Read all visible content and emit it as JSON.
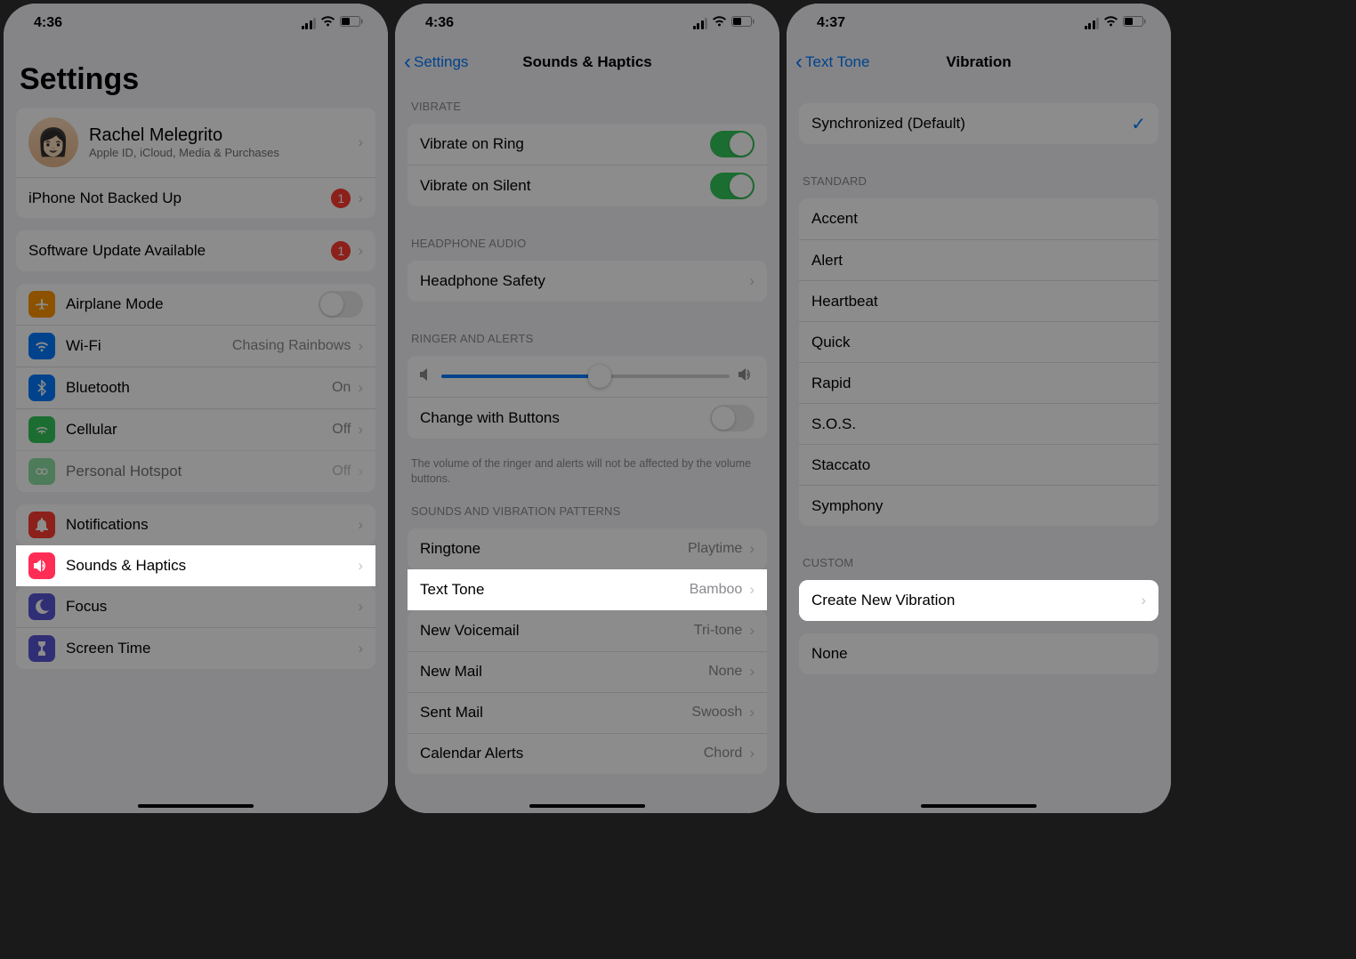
{
  "screen1": {
    "time": "4:36",
    "title": "Settings",
    "profile": {
      "name": "Rachel Melegrito",
      "subtitle": "Apple ID, iCloud, Media & Purchases"
    },
    "backup": {
      "label": "iPhone Not Backed Up",
      "badge": "1"
    },
    "update": {
      "label": "Software Update Available",
      "badge": "1"
    },
    "rows": {
      "airplane": "Airplane Mode",
      "wifi": {
        "label": "Wi-Fi",
        "value": "Chasing Rainbows"
      },
      "bluetooth": {
        "label": "Bluetooth",
        "value": "On"
      },
      "cellular": {
        "label": "Cellular",
        "value": "Off"
      },
      "hotspot": {
        "label": "Personal Hotspot",
        "value": "Off"
      },
      "notifications": "Notifications",
      "sounds": "Sounds & Haptics",
      "focus": "Focus",
      "screentime": "Screen Time"
    }
  },
  "screen2": {
    "time": "4:36",
    "back": "Settings",
    "title": "Sounds & Haptics",
    "sections": {
      "vibrate": "Vibrate",
      "headphone": "Headphone Audio",
      "ringer": "Ringer and Alerts",
      "patterns": "Sounds and Vibration Patterns"
    },
    "rows": {
      "vibrateRing": "Vibrate on Ring",
      "vibrateSilent": "Vibrate on Silent",
      "headphoneSafety": "Headphone Safety",
      "changeButtons": "Change with Buttons",
      "ringtone": {
        "label": "Ringtone",
        "value": "Playtime"
      },
      "textTone": {
        "label": "Text Tone",
        "value": "Bamboo"
      },
      "voicemail": {
        "label": "New Voicemail",
        "value": "Tri-tone"
      },
      "newMail": {
        "label": "New Mail",
        "value": "None"
      },
      "sentMail": {
        "label": "Sent Mail",
        "value": "Swoosh"
      },
      "calendar": {
        "label": "Calendar Alerts",
        "value": "Chord"
      }
    },
    "footer": "The volume of the ringer and alerts will not be affected by the volume buttons."
  },
  "screen3": {
    "time": "4:37",
    "back": "Text Tone",
    "title": "Vibration",
    "synchronized": "Synchronized (Default)",
    "sections": {
      "standard": "Standard",
      "custom": "Custom"
    },
    "standard": [
      "Accent",
      "Alert",
      "Heartbeat",
      "Quick",
      "Rapid",
      "S.O.S.",
      "Staccato",
      "Symphony"
    ],
    "create": "Create New Vibration",
    "none": "None"
  }
}
